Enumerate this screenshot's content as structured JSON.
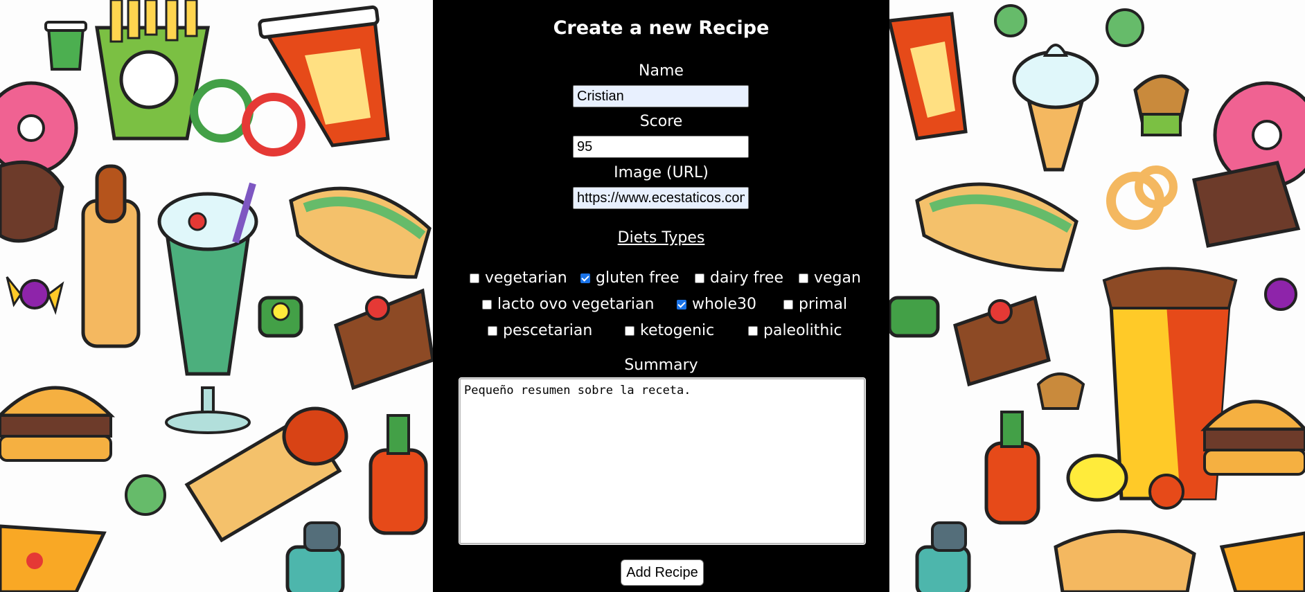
{
  "form": {
    "title": "Create a new Recipe",
    "name_label": "Name",
    "name_value": "Cristian",
    "score_label": "Score",
    "score_value": "95",
    "image_label": "Image (URL)",
    "image_value": "https://www.ecestaticos.com",
    "diets_title": "Diets Types",
    "diets": [
      {
        "label": "vegetarian",
        "checked": false
      },
      {
        "label": "gluten free",
        "checked": true
      },
      {
        "label": "dairy free",
        "checked": false
      },
      {
        "label": "vegan",
        "checked": false
      },
      {
        "label": "lacto ovo vegetarian",
        "checked": false
      },
      {
        "label": "whole30",
        "checked": true
      },
      {
        "label": "primal",
        "checked": false
      },
      {
        "label": "pescetarian",
        "checked": false
      },
      {
        "label": "ketogenic",
        "checked": false
      },
      {
        "label": "paleolithic",
        "checked": false
      }
    ],
    "summary_label": "Summary",
    "summary_value": "Pequeño resumen sobre la receta.",
    "submit_label": "Add Recipe"
  },
  "theme": {
    "panel_bg": "#000000",
    "checkbox_accent": "#1a73e8",
    "autofill_bg": "#e8f0fe"
  },
  "background": {
    "icons": [
      "coffee-cup-icon",
      "french-fries-icon",
      "soda-cup-icon",
      "donut-icon",
      "ice-cream-icon",
      "hot-dog-icon",
      "milkshake-icon",
      "candy-icon",
      "burger-icon",
      "burrito-icon",
      "ketchup-bottle-icon",
      "pizza-icon",
      "cake-slice-icon",
      "muffin-icon",
      "onion-rings-icon",
      "lemon-icon",
      "salt-shaker-icon"
    ]
  }
}
